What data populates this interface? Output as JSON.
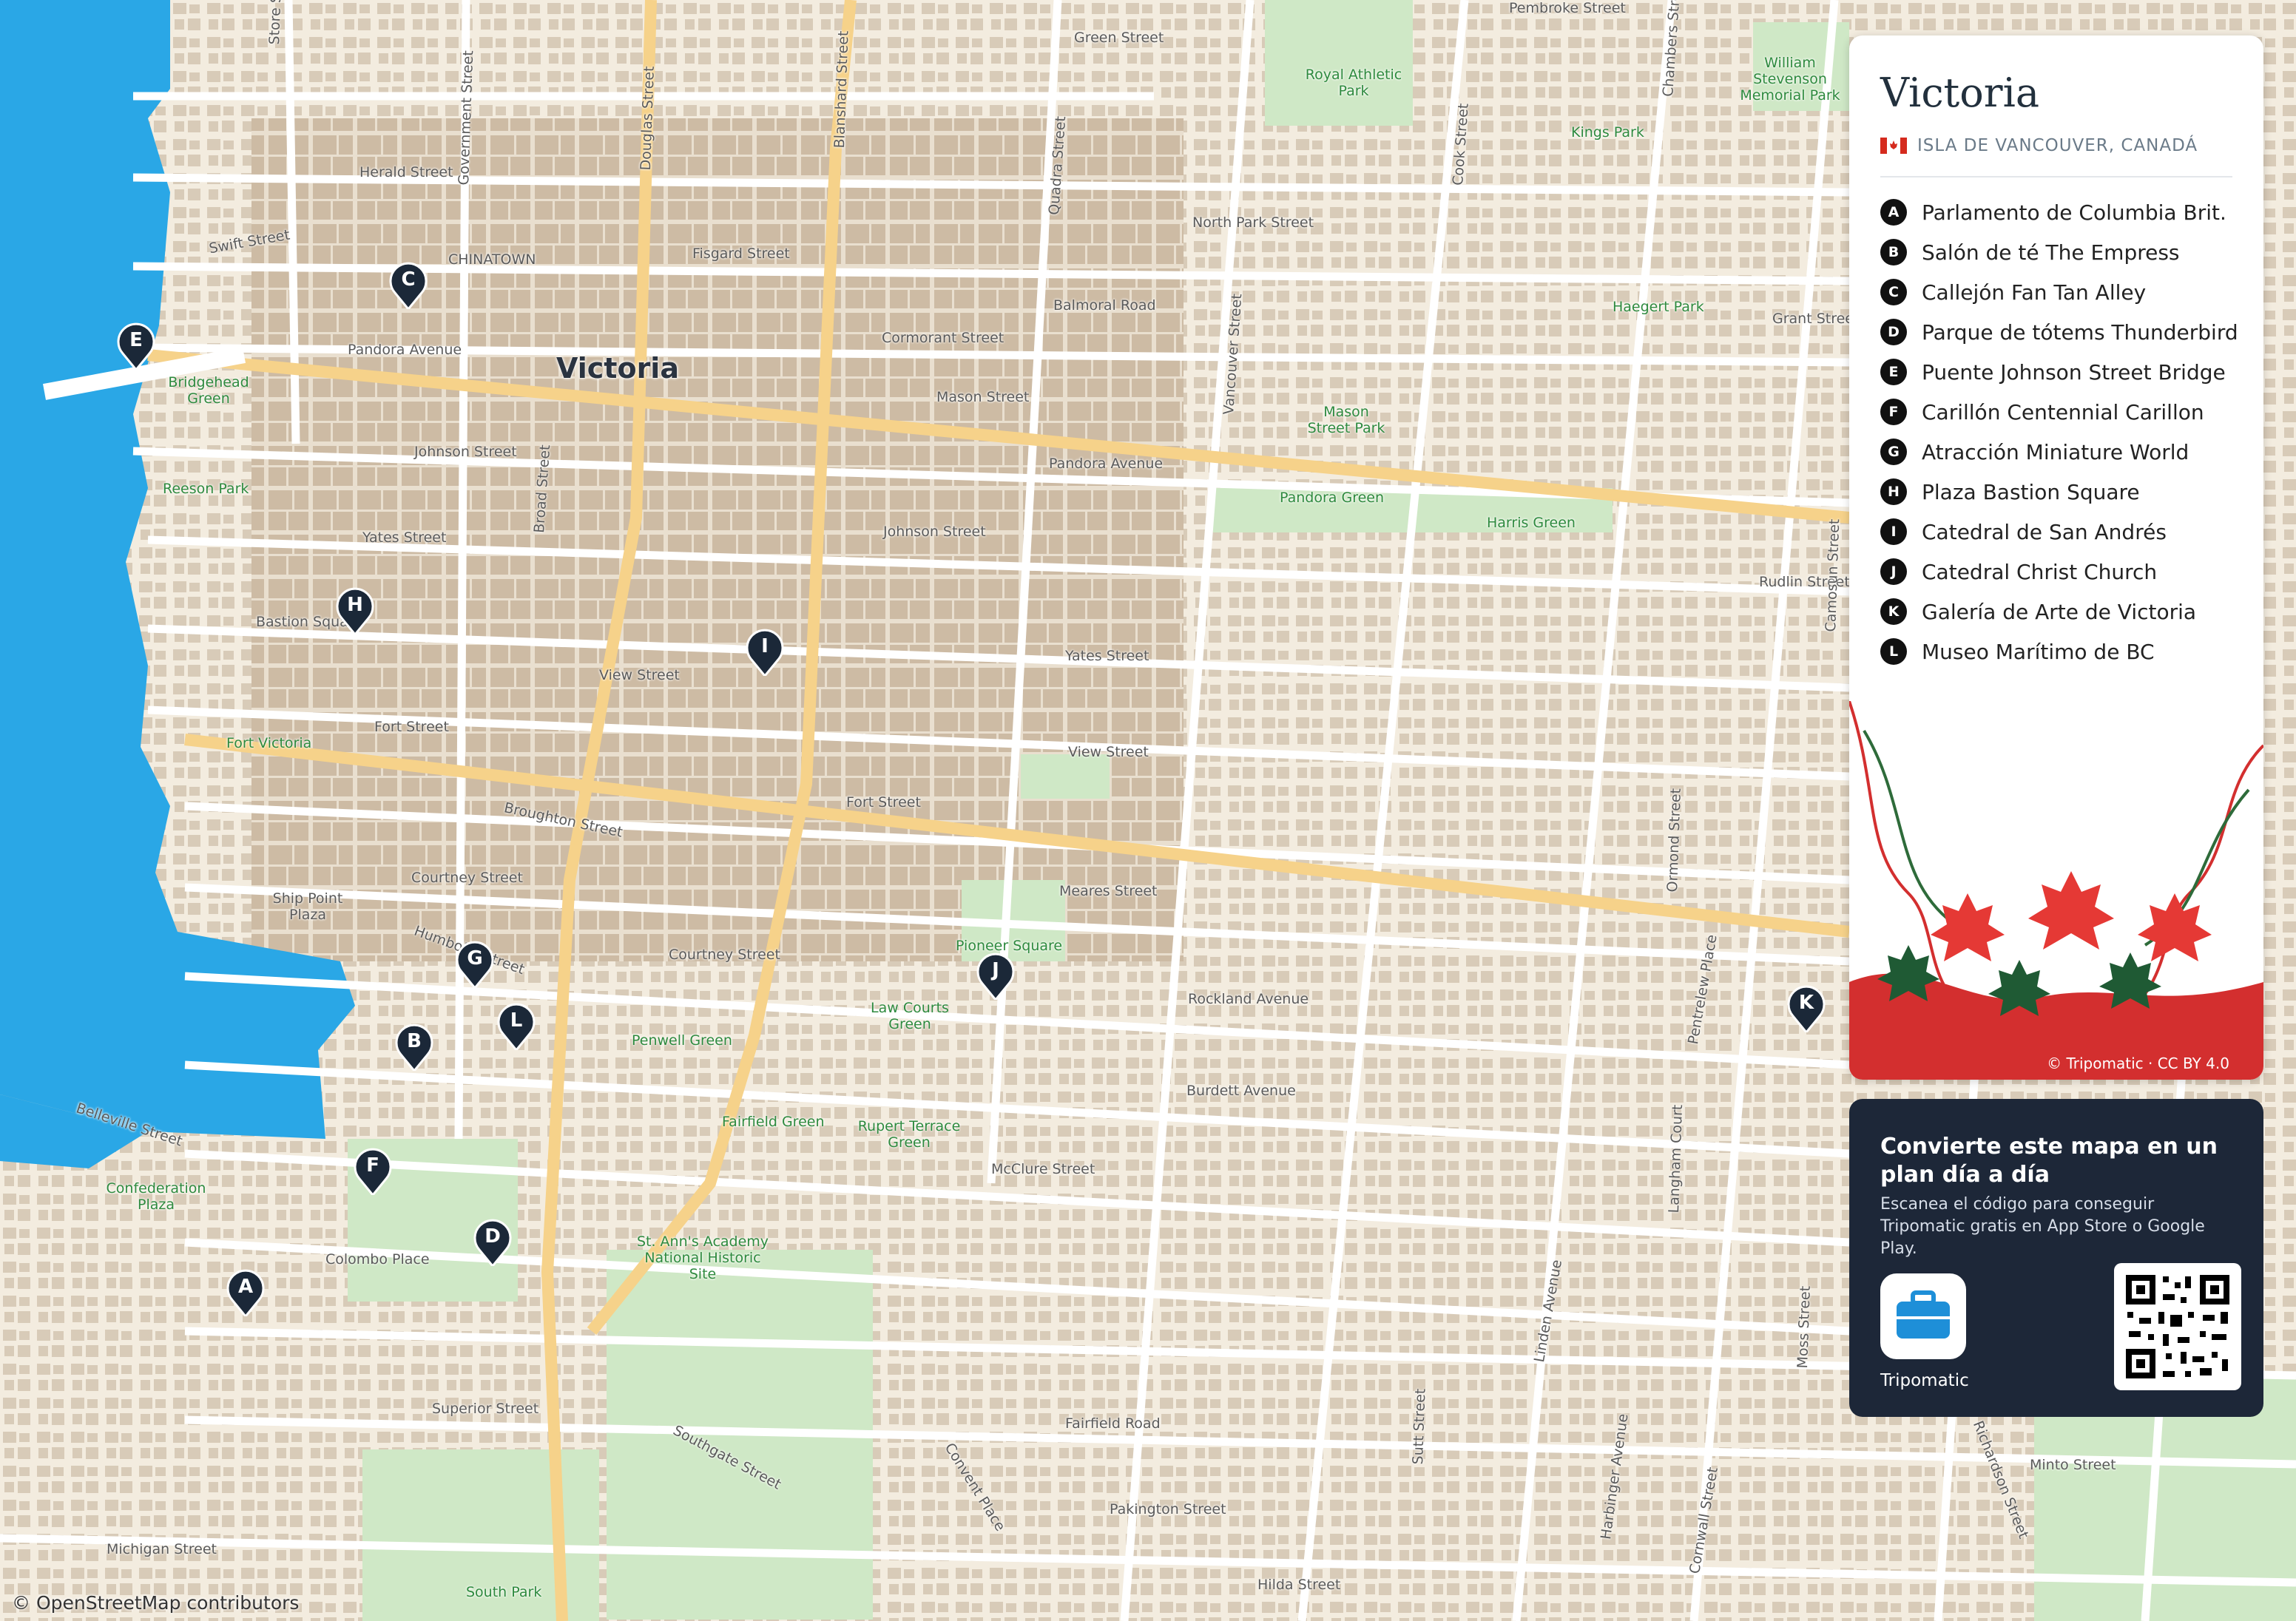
{
  "map": {
    "city_label": "Victoria",
    "attribution": "© OpenStreetMap contributors",
    "colors": {
      "water": "#2aa7e6",
      "land": "#f3ecdf",
      "park": "#cfe8c6",
      "major_road": "#f6d28a",
      "pin": "#1b2838"
    },
    "street_labels": [
      "Store Street",
      "Government Street",
      "Douglas Street",
      "Blanshard Street",
      "Quadra Street",
      "Vancouver Street",
      "Cook Street",
      "Chambers Street",
      "Herald Street",
      "Swift Street",
      "Fisgard Street",
      "Green Street",
      "North Park Street",
      "Balmoral Road",
      "Cormorant Street",
      "Mason Street",
      "Pandora Avenue",
      "Johnson Street",
      "Yates Street",
      "View Street",
      "Fort Street",
      "Broughton Street",
      "Courtney Street",
      "Meares Street",
      "Humboldt Street",
      "Rockland Avenue",
      "Burdett Avenue",
      "McClure Street",
      "Belleville Street",
      "Colombo Place",
      "Superior Street",
      "Michigan Street",
      "Fairfield Road",
      "Southgate Street",
      "Convent Place",
      "Pakington Street",
      "Grant Street",
      "Rudlin Street",
      "Camosun Street",
      "Ormond Street",
      "Pentrelew Place",
      "Langham Court",
      "Moss Street",
      "Linden Avenue",
      "Harbinger Avenue",
      "Cornwall Street",
      "Richardson Street",
      "Minto Street",
      "Hilda Street",
      "Sutt Street",
      "Pembroke Street",
      "Broad Street"
    ],
    "place_labels": [
      "Royal Athletic Park",
      "William Stevenson Memorial Park",
      "Kings Park",
      "CHINATOWN",
      "Haegert Park",
      "Mason Street Park",
      "Pandora Green",
      "Harris Green",
      "Bridgehead Green",
      "Reeson Park",
      "Bastion Square",
      "Fort Victoria",
      "Ship Point Plaza",
      "Pioneer Square",
      "Law Courts Green",
      "Penwell Green",
      "Fairfield Green",
      "Rupert Terrace Green",
      "Confederation Plaza",
      "St. Ann's Academy National Historic Site",
      "South Park"
    ]
  },
  "pins": [
    {
      "letter": "A"
    },
    {
      "letter": "B"
    },
    {
      "letter": "C"
    },
    {
      "letter": "D"
    },
    {
      "letter": "E"
    },
    {
      "letter": "F"
    },
    {
      "letter": "G"
    },
    {
      "letter": "H"
    },
    {
      "letter": "I"
    },
    {
      "letter": "J"
    },
    {
      "letter": "K"
    },
    {
      "letter": "L"
    }
  ],
  "panel": {
    "title": "Victoria",
    "subtitle": "ISLA DE VANCOUVER, CANADÁ",
    "flag": "canada-flag-icon",
    "legend": [
      {
        "letter": "A",
        "label": "Parlamento de Columbia Brit."
      },
      {
        "letter": "B",
        "label": "Salón de té The Empress"
      },
      {
        "letter": "C",
        "label": "Callejón Fan Tan Alley"
      },
      {
        "letter": "D",
        "label": "Parque de tótems Thunderbird"
      },
      {
        "letter": "E",
        "label": "Puente Johnson Street Bridge"
      },
      {
        "letter": "F",
        "label": "Carillón Centennial Carillon"
      },
      {
        "letter": "G",
        "label": "Atracción Miniature World"
      },
      {
        "letter": "H",
        "label": "Plaza Bastion Square"
      },
      {
        "letter": "I",
        "label": "Catedral de San Andrés"
      },
      {
        "letter": "J",
        "label": "Catedral Christ Church"
      },
      {
        "letter": "K",
        "label": "Galería de Arte de Victoria"
      },
      {
        "letter": "L",
        "label": "Museo Marítimo de BC"
      }
    ],
    "copyright": "© Tripomatic · CC BY 4.0"
  },
  "promo": {
    "heading": "Convierte este mapa en un plan día a día",
    "body": "Escanea el código para conseguir Tripomatic gratis en App Store o Google Play.",
    "app_name": "Tripomatic",
    "app_icon": "suitcase-icon",
    "qr_icon": "qr-code-icon"
  }
}
